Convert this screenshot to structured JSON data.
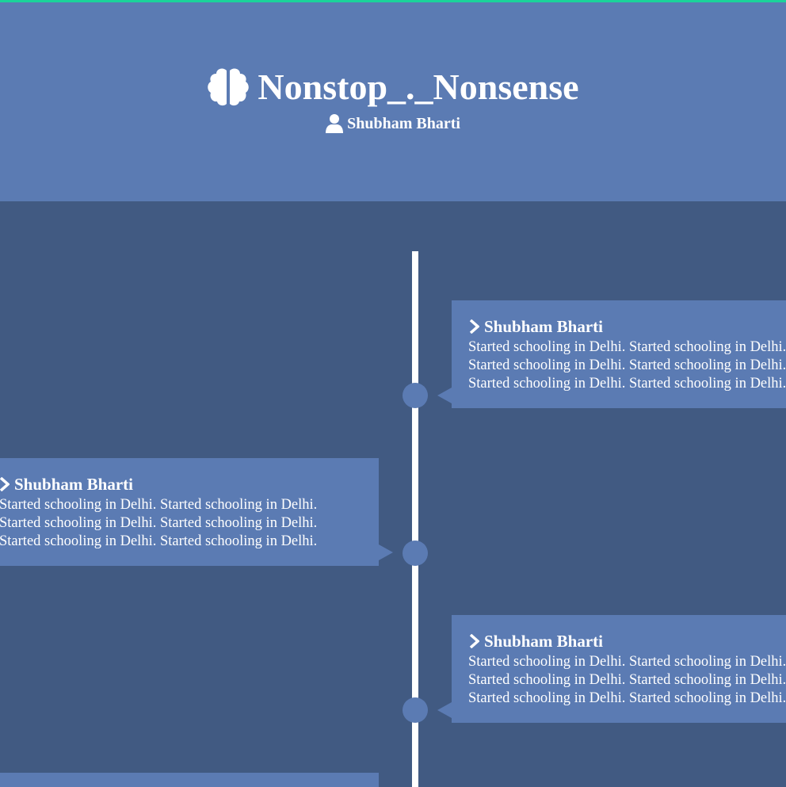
{
  "header": {
    "title": "Nonstop_._Nonsense",
    "author": "Shubham Bharti",
    "title_icon": "brain-icon",
    "author_icon": "user-icon"
  },
  "timeline": {
    "entries": [
      {
        "side": "right",
        "title": "Shubham Bharti",
        "lines": [
          "Started schooling in Delhi. Started schooling in Delhi.",
          "Started schooling in Delhi. Started schooling in Delhi.",
          "Started schooling in Delhi. Started schooling in Delhi."
        ]
      },
      {
        "side": "left",
        "title": "Shubham Bharti",
        "lines": [
          "Started schooling in Delhi. Started schooling in Delhi.",
          "Started schooling in Delhi. Started schooling in Delhi.",
          "Started schooling in Delhi. Started schooling in Delhi."
        ]
      },
      {
        "side": "right",
        "title": "Shubham Bharti",
        "lines": [
          "Started schooling in Delhi. Started schooling in Delhi.",
          "Started schooling in Delhi. Started schooling in Delhi.",
          "Started schooling in Delhi. Started schooling in Delhi."
        ]
      },
      {
        "side": "left",
        "title": "",
        "lines": []
      }
    ]
  },
  "colors": {
    "background": "#415a82",
    "header": "#5b7bb3",
    "card": "#5b7bb3",
    "accent_top": "#1bd39a",
    "text": "#ffffff"
  }
}
